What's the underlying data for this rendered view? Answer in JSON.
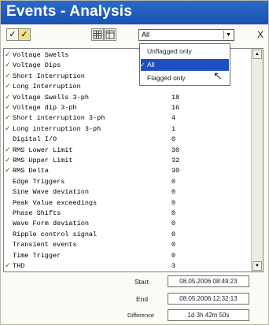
{
  "window": {
    "title": "Events - Analysis"
  },
  "toolbar": {
    "filter": {
      "selected": "All",
      "options": [
        "Unflagged only",
        "All",
        "Flagged only"
      ]
    },
    "close_label": "X",
    "check_mark": "✓"
  },
  "events": [
    {
      "label": "Voltage Swells",
      "value": "",
      "checked": true
    },
    {
      "label": "Voltage Dips",
      "value": "",
      "checked": true
    },
    {
      "label": "Short Interruption",
      "value": "",
      "checked": true
    },
    {
      "label": "Long Interruption",
      "value": "",
      "checked": true
    },
    {
      "label": "Voltage Swells 3-ph",
      "value": "18",
      "checked": true
    },
    {
      "label": "Voltage dip 3-ph",
      "value": "16",
      "checked": true
    },
    {
      "label": "Short interruption 3-ph",
      "value": "4",
      "checked": true
    },
    {
      "label": "Long interruption 3-ph",
      "value": "1",
      "checked": true
    },
    {
      "label": "Digital I/O",
      "value": "0",
      "checked": false
    },
    {
      "label": "RMS Lower Limit",
      "value": "30",
      "checked": true
    },
    {
      "label": "RMS Upper Limit",
      "value": "32",
      "checked": true
    },
    {
      "label": "RMS Delta",
      "value": "30",
      "checked": true
    },
    {
      "label": "Edge Triggers",
      "value": "0",
      "checked": false
    },
    {
      "label": "Sine Wave deviation",
      "value": "0",
      "checked": false
    },
    {
      "label": "Peak Value exceedings",
      "value": "0",
      "checked": false
    },
    {
      "label": "Phase Shifts",
      "value": "0",
      "checked": false
    },
    {
      "label": "Wave Form deviation",
      "value": "0",
      "checked": false
    },
    {
      "label": "Ripple control signal",
      "value": "0",
      "checked": false
    },
    {
      "label": "Transient events",
      "value": "0",
      "checked": false
    },
    {
      "label": "Time Trigger",
      "value": "0",
      "checked": false
    },
    {
      "label": "THD",
      "value": "3",
      "checked": true
    }
  ],
  "footer": {
    "start_label": "Start",
    "start_value": "08.05.2006 08:49:23",
    "end_label": "End",
    "end_value": "08.05.2006 12:32:13",
    "difference_label": "Difference",
    "difference_value": "1d 3h 42m 50s"
  }
}
